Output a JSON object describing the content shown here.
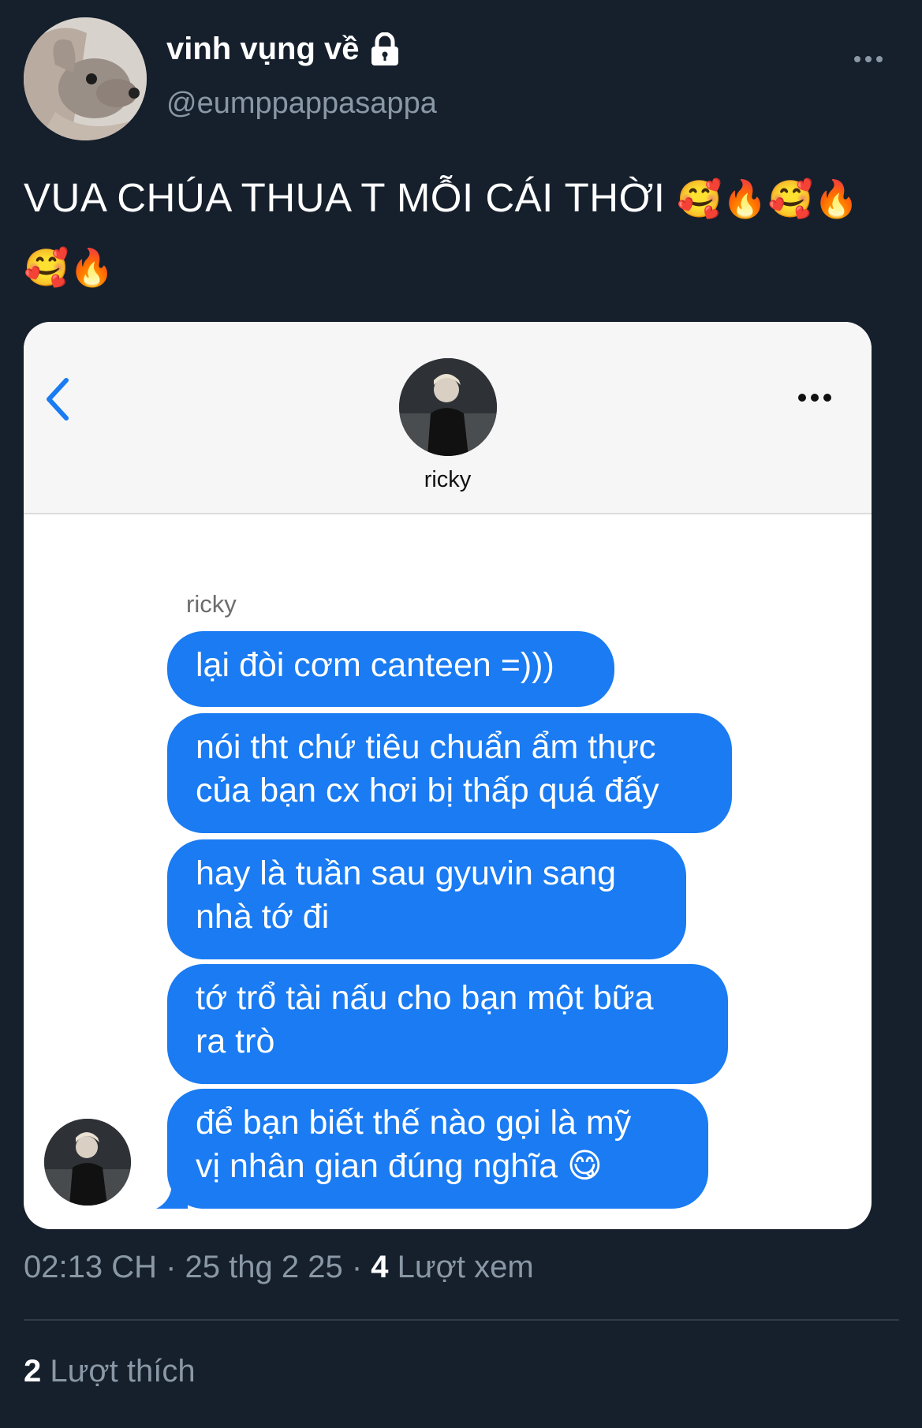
{
  "tweet": {
    "display_name": "vinh vụng về",
    "handle": "@eumppappasappa",
    "text": "VUA CHÚA THUA T MỖI CÁI THỜI",
    "emoji_line1": "🥰🔥🥰🔥",
    "emoji_line2": "🥰🔥"
  },
  "chat": {
    "contact_name": "ricky",
    "sender_label": "ricky",
    "messages": [
      {
        "line1": "lại đòi cơm canteen =)))",
        "line2": ""
      },
      {
        "line1": "nói tht chứ tiêu chuẩn ẩm thực",
        "line2": "của bạn cx hơi bị thấp quá đấy"
      },
      {
        "line1": "hay là tuần sau gyuvin sang",
        "line2": "nhà tớ đi"
      },
      {
        "line1": "tớ trổ tài nấu cho bạn một bữa",
        "line2": "ra trò"
      },
      {
        "line1": "để bạn biết thế nào gọi là mỹ",
        "line2": "vị nhân gian đúng nghĩa 😋"
      }
    ]
  },
  "meta": {
    "time": "02:13 CH",
    "separator": " · ",
    "date": "25 thg 2 25",
    "views_count": "4",
    "views_label": " Lượt xem"
  },
  "likes": {
    "count": "2",
    "label": " Lượt thích"
  },
  "colors": {
    "background": "#16202c",
    "bubble": "#1a7bf2",
    "muted": "#8a98a6"
  }
}
